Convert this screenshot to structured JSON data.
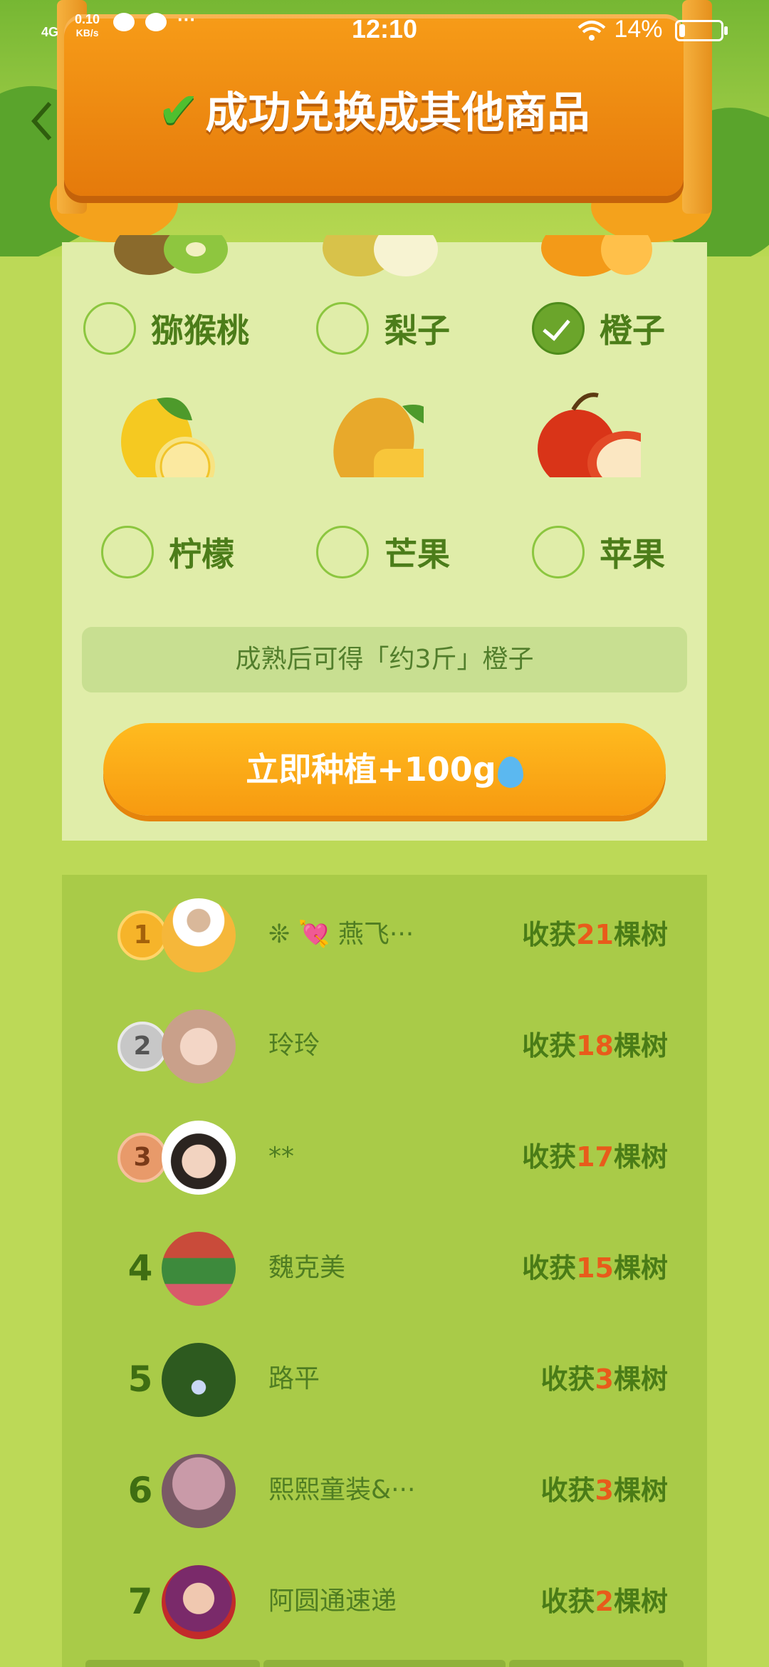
{
  "status_bar": {
    "network": "4G",
    "speed": "0.10",
    "speed_unit": "KB/s",
    "time": "12:10",
    "battery_text": "14%",
    "battery_level": 0.14
  },
  "header": {
    "title": "成功兑换成其他商品"
  },
  "fruits": [
    {
      "name": "猕猴桃",
      "selected": false
    },
    {
      "name": "梨子",
      "selected": false
    },
    {
      "name": "橙子",
      "selected": true
    },
    {
      "name": "柠檬",
      "selected": false
    },
    {
      "name": "芒果",
      "selected": false
    },
    {
      "name": "苹果",
      "selected": false
    }
  ],
  "info_text": "成熟后可得「约3斤」橙子",
  "cta_label": "立即种植+100g",
  "leaderboard": [
    {
      "rank": "1",
      "name": "❊ 💘 燕飞···",
      "prefix": "收获",
      "count": "21",
      "suffix": "棵树"
    },
    {
      "rank": "2",
      "name": "玲玲",
      "prefix": "收获",
      "count": "18",
      "suffix": "棵树"
    },
    {
      "rank": "3",
      "name": "**",
      "prefix": "收获",
      "count": "17",
      "suffix": "棵树"
    },
    {
      "rank": "4",
      "name": "魏克美",
      "prefix": "收获",
      "count": "15",
      "suffix": "棵树"
    },
    {
      "rank": "5",
      "name": "路平",
      "prefix": "收获",
      "count": "3",
      "suffix": "棵树"
    },
    {
      "rank": "6",
      "name": "熙熙童装&···",
      "prefix": "收获",
      "count": "3",
      "suffix": "棵树"
    },
    {
      "rank": "7",
      "name": "阿圆通速递",
      "prefix": "收获",
      "count": "2",
      "suffix": "棵树"
    }
  ],
  "colors": {
    "background": "#bcd957",
    "panel": "#e0eda9",
    "accent_orange": "#f79a10",
    "text_green": "#4c7d1a",
    "count_red": "#e85b1b"
  }
}
